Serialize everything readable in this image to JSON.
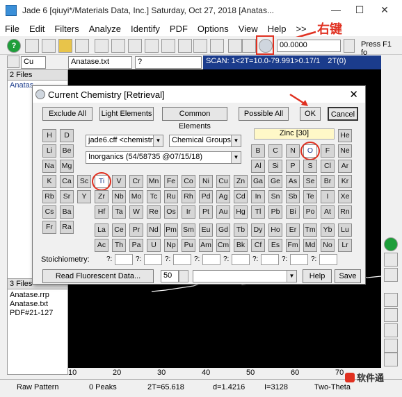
{
  "window": {
    "title": "Jade 6 [qiuyi*/Materials Data, Inc.] Saturday, Oct 27, 2018 [Anatas...",
    "controls": [
      "—",
      "☐",
      "✕"
    ]
  },
  "menu": [
    "File",
    "Edit",
    "Filters",
    "Analyze",
    "Identify",
    "PDF",
    "Options",
    "View",
    "Help",
    ">>"
  ],
  "annotation": {
    "label": "右键",
    "color": "#e03020"
  },
  "toolbar": {
    "counter_value": "00.0000",
    "help_hint": "Press F1 fo"
  },
  "toolbar2": {
    "element_combo": "Cu",
    "file_combo": "Anatase.txt",
    "field_q": "?"
  },
  "scanbar": {
    "text": "SCAN: 1<2T=10.0-79.991>0.17/1",
    "mode": "2T(0)"
  },
  "leftpanel": {
    "top_header": "2 Files",
    "top_items": [
      "Anatas"
    ],
    "bottom_header": "3 Files",
    "bottom_items": [
      "Anatase.rrp",
      "Anatase.txt",
      "PDF#21-127"
    ]
  },
  "plot": {
    "x_ticks": [
      "10",
      "20",
      "30",
      "40",
      "50",
      "60",
      "70"
    ]
  },
  "statusbar": {
    "pattern": "Raw Pattern",
    "peaks": "0 Peaks",
    "twotheta": "2T=65.618",
    "d": "d=1.4216",
    "intensity": "I=3128",
    "axis": "Two-Theta"
  },
  "watermark": {
    "text": "软件通"
  },
  "dialog": {
    "title": "Current Chemistry [Retrieval]",
    "close": "✕",
    "buttons": {
      "exclude_all": "Exclude All",
      "light_elements": "Light Elements",
      "common_elements": "Common Elements",
      "possible_all": "Possible All",
      "ok": "OK",
      "cancel": "Cancel",
      "read_fluorescent": "Read Fluorescent Data...",
      "help": "Help",
      "save": "Save"
    },
    "database_combo": "jade6.cff <chemistry>",
    "groups_combo": "Chemical Groups",
    "inorganics_combo": "Inorganics (54/58735 @07/15/18)",
    "selected_element_info": "Zinc [30]",
    "stoichiometry_label": "Stoichiometry:",
    "stoich_placeholders": [
      "?:",
      "?:",
      "?:",
      "?:",
      "?:",
      "?:",
      "?:",
      "?:"
    ],
    "spinner_value": "50",
    "elements": {
      "row1a": [
        "H",
        "D"
      ],
      "row1b": [
        "He"
      ],
      "row2a": [
        "Li",
        "Be"
      ],
      "row2b": [
        "B",
        "C",
        "N",
        "O",
        "F",
        "Ne"
      ],
      "row3a": [
        "Na",
        "Mg"
      ],
      "row3b": [
        "Al",
        "Si",
        "P",
        "S",
        "Cl",
        "Ar"
      ],
      "row4": [
        "K",
        "Ca",
        "Sc",
        "Ti",
        "V",
        "Cr",
        "Mn",
        "Fe",
        "Co",
        "Ni",
        "Cu",
        "Zn",
        "Ga",
        "Ge",
        "As",
        "Se",
        "Br",
        "Kr"
      ],
      "row5": [
        "Rb",
        "Sr",
        "Y",
        "Zr",
        "Nb",
        "Mo",
        "Tc",
        "Ru",
        "Rh",
        "Pd",
        "Ag",
        "Cd",
        "In",
        "Sn",
        "Sb",
        "Te",
        "I",
        "Xe"
      ],
      "row6": [
        "Cs",
        "Ba",
        "Hf",
        "Ta",
        "W",
        "Re",
        "Os",
        "Ir",
        "Pt",
        "Au",
        "Hg",
        "Tl",
        "Pb",
        "Bi",
        "Po",
        "At",
        "Rn"
      ],
      "row7": [
        "Fr",
        "Ra"
      ],
      "lanth": [
        "La",
        "Ce",
        "Pr",
        "Nd",
        "Pm",
        "Sm",
        "Eu",
        "Gd",
        "Tb",
        "Dy",
        "Ho",
        "Er",
        "Tm",
        "Yb",
        "Lu"
      ],
      "actin": [
        "Ac",
        "Th",
        "Pa",
        "U",
        "Np",
        "Pu",
        "Am",
        "Cm",
        "Bk",
        "Cf",
        "Es",
        "Fm",
        "Md",
        "No",
        "Lr"
      ]
    }
  }
}
